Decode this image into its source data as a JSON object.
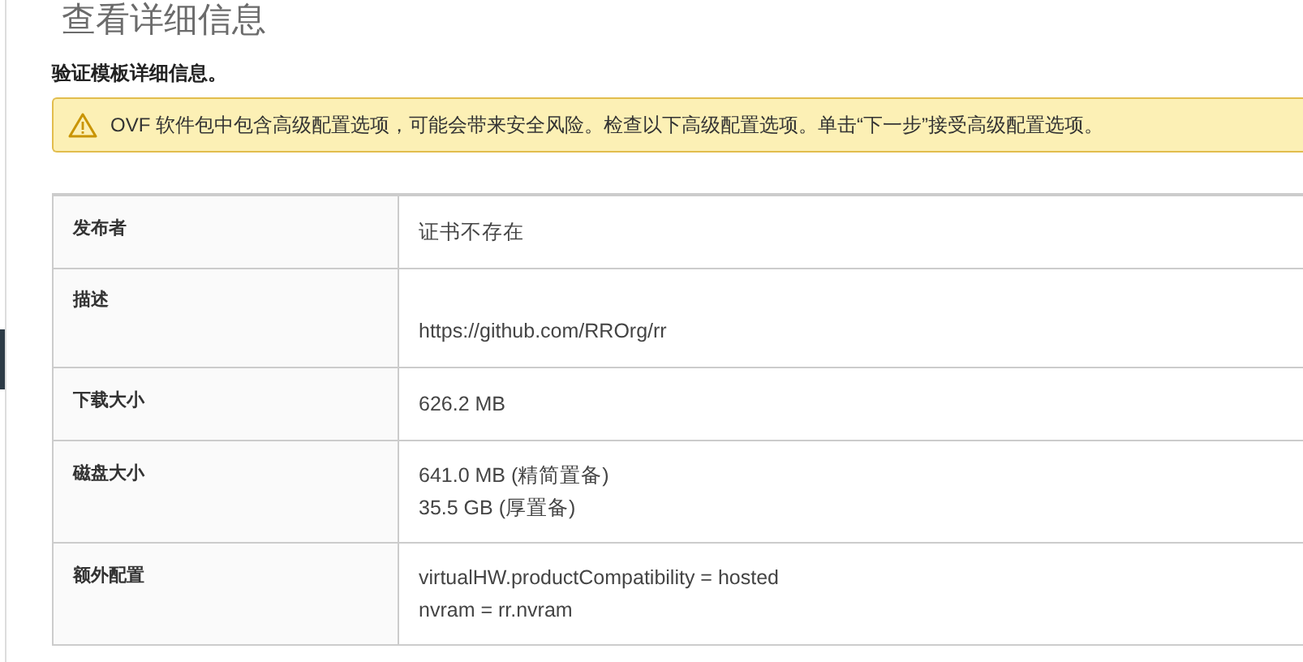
{
  "title": "查看详细信息",
  "subtitle": "验证模板详细信息。",
  "alert": {
    "kind": "warning",
    "text": "OVF 软件包中包含高级配置选项，可能会带来安全风险。检查以下高级配置选项。单击“下一步”接受高级配置选项。"
  },
  "details": [
    {
      "kind": "plain",
      "label": "发布者",
      "lines": [
        "证书不存在"
      ]
    },
    {
      "kind": "description",
      "label": "描述",
      "lines": [
        "https://github.com/RROrg/rr"
      ]
    },
    {
      "kind": "plain",
      "label": "下载大小",
      "lines": [
        "626.2 MB"
      ]
    },
    {
      "kind": "plain",
      "label": "磁盘大小",
      "lines": [
        "641.0 MB (精简置备)",
        "35.5 GB (厚置备)"
      ]
    },
    {
      "kind": "plain",
      "label": "额外配置",
      "lines": [
        "virtualHW.productCompatibility = hosted",
        "nvram = rr.nvram"
      ]
    }
  ]
}
